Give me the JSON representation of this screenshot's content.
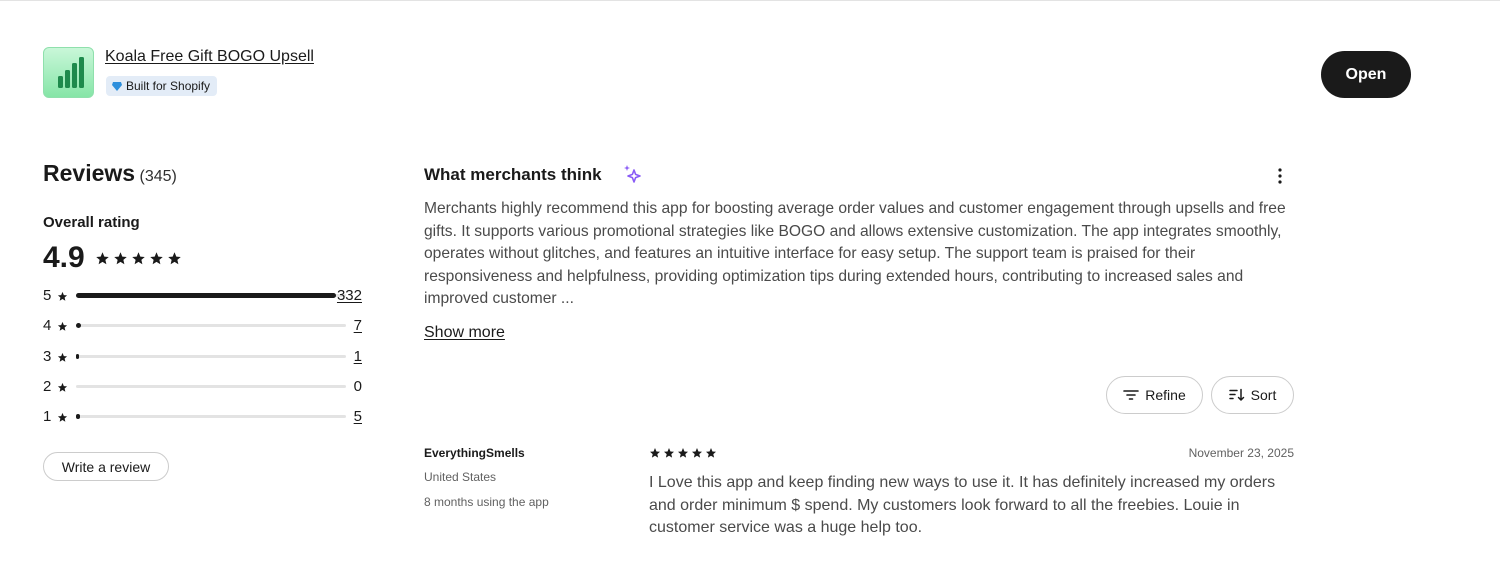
{
  "app": {
    "name": "Koala Free Gift BOGO Upsell",
    "badge": "Built for Shopify",
    "open_label": "Open",
    "icon": "bar-chart-icon",
    "icon_color": "#86e5a7"
  },
  "reviews": {
    "title": "Reviews",
    "count": "(345)",
    "overall_label": "Overall rating",
    "rating": "4.9",
    "stars": 5,
    "distribution": [
      {
        "label": "5",
        "count": "332",
        "fraction": 0.962
      },
      {
        "label": "4",
        "count": "7",
        "fraction": 0.02
      },
      {
        "label": "3",
        "count": "1",
        "fraction": 0.003
      },
      {
        "label": "2",
        "count": "0",
        "fraction": 0
      },
      {
        "label": "1",
        "count": "5",
        "fraction": 0.014
      }
    ],
    "write_review_label": "Write a review"
  },
  "merchants": {
    "title": "What merchants think",
    "summary": "Merchants highly recommend this app for boosting average order values and customer engagement through upsells and free gifts. It supports various promotional strategies like BOGO and allows extensive customization. The app integrates smoothly, operates without glitches, and features an intuitive interface for easy setup. The support team is praised for their responsiveness and helpfulness, providing optimization tips during extended hours, contributing to increased sales and improved customer ...",
    "show_more": "Show more",
    "accent_color": "#8a5cf6"
  },
  "controls": {
    "refine_label": "Refine",
    "sort_label": "Sort"
  },
  "review_items": [
    {
      "author": "EverythingSmells",
      "country": "United States",
      "usage": "8 months using the app",
      "stars": 5,
      "date": "November 23, 2025",
      "body": "I Love this app and keep finding new ways to use it. It has definitely increased my orders and order minimum $ spend. My customers look forward to all the freebies. Louie in customer service was a huge help too."
    }
  ]
}
